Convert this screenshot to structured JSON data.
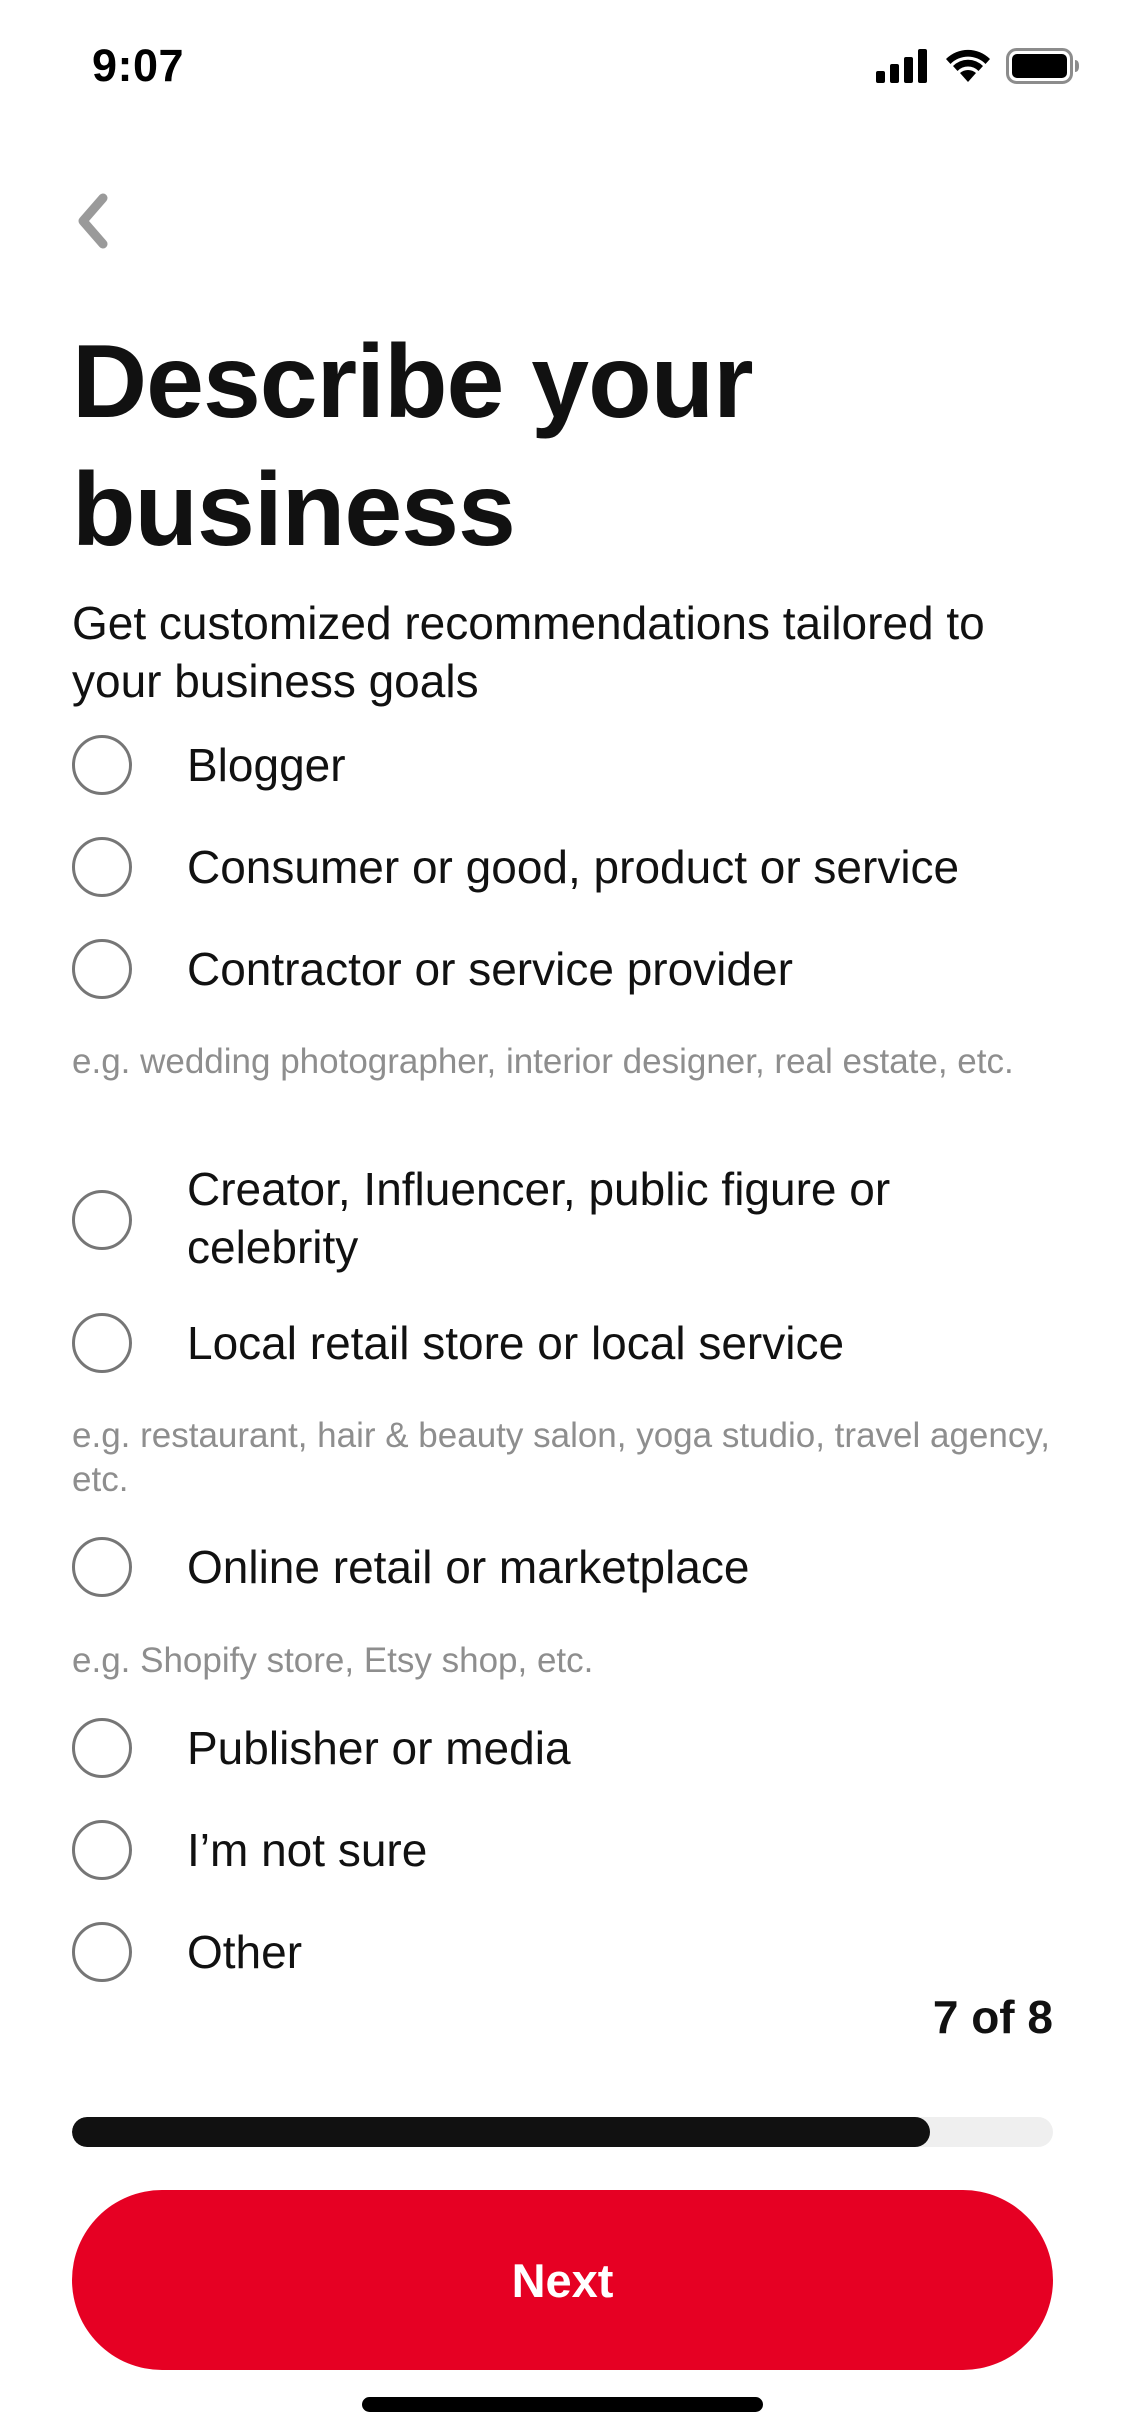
{
  "status_bar": {
    "time": "9:07",
    "icons": [
      "cellular-signal-icon",
      "wifi-icon",
      "battery-icon"
    ]
  },
  "nav": {
    "back_icon": "chevron-left-icon"
  },
  "header": {
    "title": "Describe your business",
    "subtitle": "Get customized recommendations tailored to your business goals"
  },
  "options": [
    {
      "label": "Blogger",
      "hint": "",
      "selected": false
    },
    {
      "label": "Consumer or good, product or service",
      "hint": "",
      "selected": false
    },
    {
      "label": "Contractor or service provider",
      "hint": "e.g. wedding photographer, interior designer, real estate, etc.",
      "selected": false
    },
    {
      "label": "Creator, Influencer, public figure or celebrity",
      "hint": "",
      "selected": false
    },
    {
      "label": "Local retail store or local service",
      "hint": "e.g. restaurant, hair & beauty salon, yoga studio, travel agency, etc.",
      "selected": false
    },
    {
      "label": "Online retail or marketplace",
      "hint": "e.g. Shopify store, Etsy shop, etc.",
      "selected": false
    },
    {
      "label": "Publisher or media",
      "hint": "",
      "selected": false
    },
    {
      "label": "I’m not sure",
      "hint": "",
      "selected": false
    },
    {
      "label": "Other",
      "hint": "",
      "selected": false
    }
  ],
  "progress": {
    "label": "7 of 8",
    "step": 7,
    "total": 8,
    "fraction": 0.875
  },
  "footer": {
    "next_label": "Next"
  },
  "colors": {
    "accent": "#e60023",
    "text": "#111111",
    "hint": "#8e8e8e",
    "radio_border": "#767676",
    "progress_track": "#efefef",
    "progress_fill": "#111111"
  }
}
